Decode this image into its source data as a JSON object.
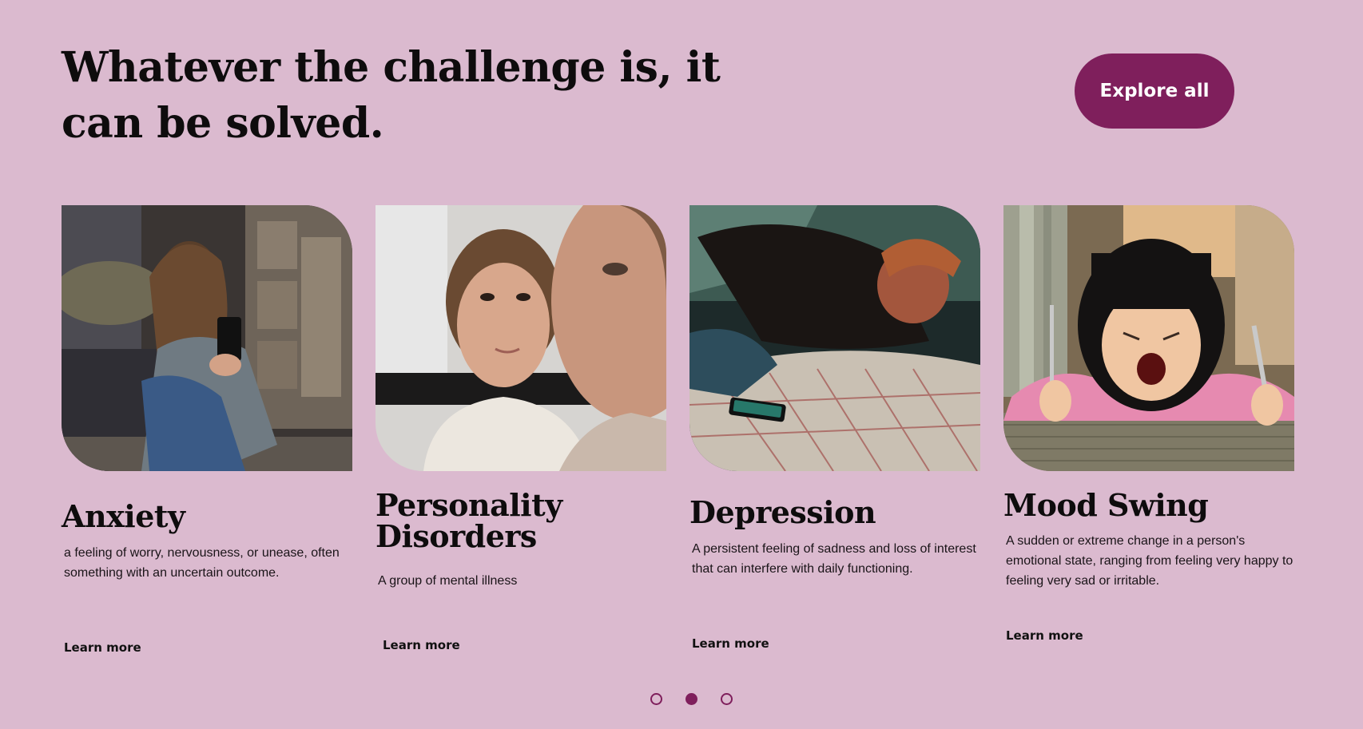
{
  "header": {
    "headline": "Whatever the challenge is, it can be solved.",
    "explore_label": "Explore all"
  },
  "cards": [
    {
      "title": "Anxiety",
      "description": "a feeling of worry, nervousness, or unease, often something with an uncertain outcome.",
      "link_label": "Learn more",
      "image": "woman-holding-head-with-phone-photo"
    },
    {
      "title": "Personality Disorders",
      "description": "A group of mental illness",
      "link_label": "Learn more",
      "image": "two-women-faces-photo"
    },
    {
      "title": "Depression",
      "description": "A persistent feeling of sadness and loss of interest that can interfere with daily functioning.",
      "link_label": "Learn more",
      "image": "man-lying-in-bed-with-phone-photo"
    },
    {
      "title": "Mood Swing",
      "description": "A sudden or extreme change in a person's emotional state, ranging from feeling very happy to feeling very sad or irritable.",
      "link_label": "Learn more",
      "image": "angry-child-with-fork-knife-photo"
    }
  ],
  "pagination": {
    "active_index": 2,
    "count": 3
  },
  "colors": {
    "background": "#dbbacf",
    "accent": "#7f1f5c",
    "text": "#0e0c0d"
  }
}
